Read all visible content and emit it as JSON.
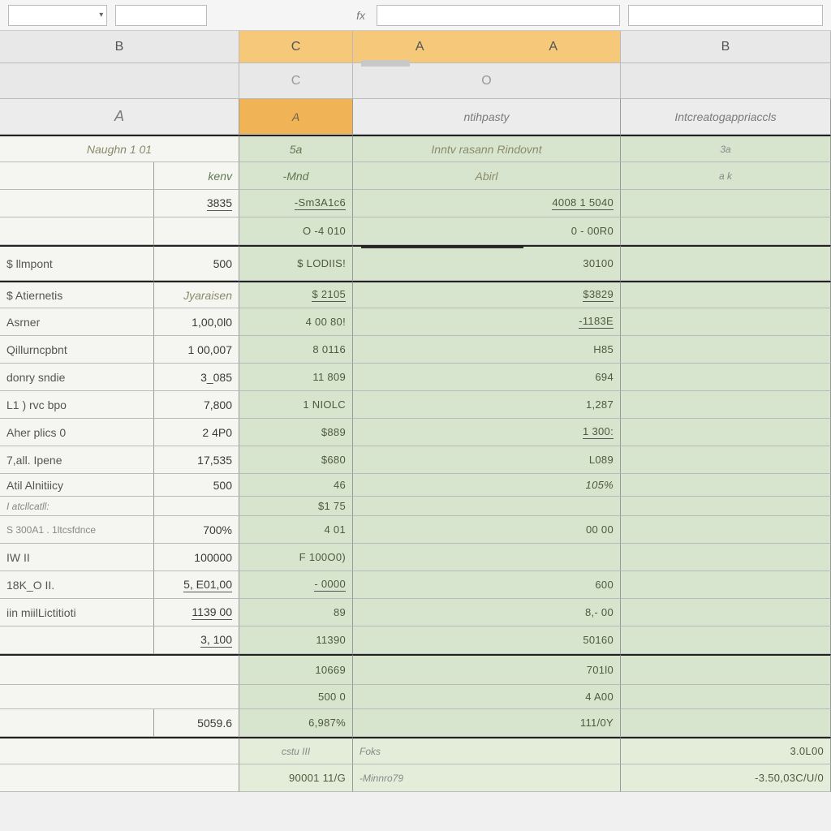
{
  "formula_bar": {
    "name_box": "",
    "dropdown_glyph": "▾",
    "fx_label": "fx",
    "formula": "",
    "extra": ""
  },
  "col_header_row1": {
    "B": "B",
    "C": "C",
    "A1": "A",
    "A2": "A",
    "B2": "B"
  },
  "col_header_row2": {
    "C": "C",
    "O": "O"
  },
  "title_row": {
    "a": "A",
    "a2": "A",
    "mid": "ntihpasty",
    "right": "Intcreatogappriaccls"
  },
  "header_row": {
    "label": "Naughn  1 01",
    "c": "5a",
    "d": "Inntv rasann Rindovnt",
    "e": "3a"
  },
  "sub_row": {
    "b": "kenv",
    "c": "-Mnd",
    "d": "Abirl",
    "e": "a k"
  },
  "rows": [
    {
      "a": "",
      "b": "3835",
      "c": "-Sm3A1c6",
      "d": "4008 1 5040",
      "e": ""
    },
    {
      "a": "",
      "b": "",
      "c": "O  -4 010",
      "d": "0 - 00R0",
      "e": ""
    }
  ],
  "import_row": {
    "a": "$ llmpont",
    "b": "500",
    "c": "$  LODIIS!",
    "d": "30100",
    "e": ""
  },
  "detail_rows": [
    {
      "a": "$ Atiernetis",
      "b": "Jyaraisen",
      "c": "$ 2105",
      "d": "$3829",
      "e": ""
    },
    {
      "a": "Asrner",
      "b": "1,00,0l0",
      "c": "4 00 80!",
      "d": "-1183E",
      "e": ""
    },
    {
      "a": "Qillurncpbnt",
      "b": "1 00,007",
      "c": "8  0116",
      "d": "H85",
      "e": ""
    },
    {
      "a": "donry sndie",
      "b": "3_085",
      "c": "11 809",
      "d": "694",
      "e": ""
    },
    {
      "a": "L1 ) rvc bpo",
      "b": "7,800",
      "c": "1 NIOLC",
      "d": "1,287",
      "e": ""
    },
    {
      "a": "Aher plics  0",
      "b": "2  4P0",
      "c": "$889",
      "d": "1 300:",
      "e": ""
    },
    {
      "a": "7,all.  Ipene",
      "b": "17,535",
      "c": "$680",
      "d": "L089",
      "e": ""
    },
    {
      "a": "Atil Alnitiicy",
      "b": "500",
      "c": "46",
      "d": "105%",
      "e": ""
    },
    {
      "a": "I  atcllcatll:",
      "b": "",
      "c": "$1 75",
      "d": "",
      "e": ""
    },
    {
      "a": "S 300A1 . 1ltcsfdnce",
      "b": "700%",
      "c": "4 01",
      "d": "00 00",
      "e": ""
    },
    {
      "a": "IW  II",
      "b": "100000",
      "c": "F 100O0)",
      "d": "",
      "e": ""
    },
    {
      "a": "18K_O  II.",
      "b": "5,  E01,00",
      "c": "- 0000",
      "d": "600",
      "e": ""
    },
    {
      "a": "iin miilLictitioti",
      "b": "1139 00",
      "c": "89",
      "d": "8,- 00",
      "e": ""
    },
    {
      "a": "",
      "b": "3, 100",
      "c": "11390",
      "d": "50160",
      "e": ""
    }
  ],
  "gap_rows": [
    {
      "a": "",
      "b": "",
      "c": "10669",
      "d": "701l0",
      "e": ""
    },
    {
      "a": "",
      "b": "",
      "c": "500 0",
      "d": "4 A00",
      "e": ""
    },
    {
      "a": "",
      "b": "5059.6",
      "c": "6,987%",
      "d": "111/0Y",
      "e": ""
    }
  ],
  "footer_rows": [
    {
      "a": "",
      "b": "",
      "c": "cstu III",
      "d": "Foks",
      "e": "3.0L00"
    },
    {
      "a": "",
      "b": "",
      "c": "90001 11/G",
      "d": "-Minnro79",
      "e": "-3.50,03C/U/0"
    }
  ]
}
